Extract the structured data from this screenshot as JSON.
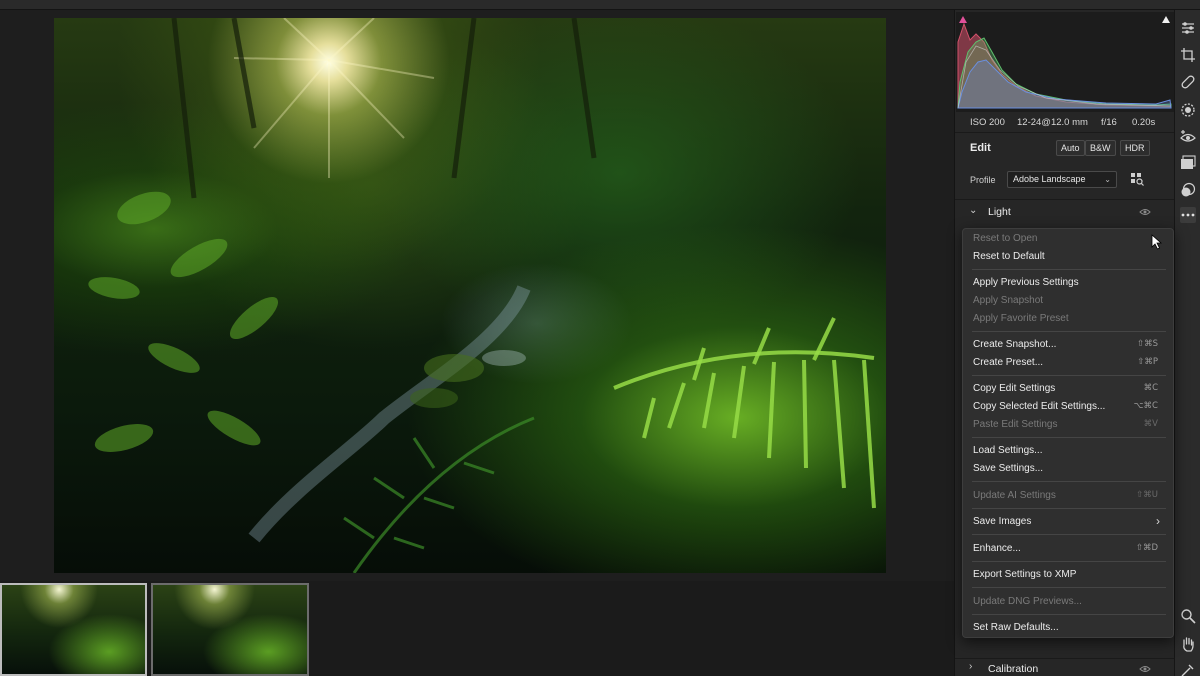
{
  "camera_info": {
    "iso": "ISO 200",
    "lens": "12-24@12.0 mm",
    "aperture": "f/16",
    "shutter": "0.20s"
  },
  "edit_panel": {
    "title": "Edit",
    "buttons": {
      "auto": "Auto",
      "bw": "B&W",
      "hdr": "HDR"
    },
    "profile_label": "Profile",
    "profile_value": "Adobe Landscape"
  },
  "sections": {
    "light": "Light",
    "calibration": "Calibration"
  },
  "context_menu": {
    "items": [
      {
        "label": "Reset to Open",
        "shortcut": "",
        "enabled": false
      },
      {
        "label": "Reset to Default",
        "shortcut": "",
        "enabled": true
      },
      {
        "label": "Apply Previous Settings",
        "shortcut": "",
        "enabled": true
      },
      {
        "label": "Apply Snapshot",
        "shortcut": "",
        "enabled": false
      },
      {
        "label": "Apply Favorite Preset",
        "shortcut": "",
        "enabled": false
      },
      {
        "label": "Create Snapshot...",
        "shortcut": "⇧⌘S",
        "enabled": true
      },
      {
        "label": "Create Preset...",
        "shortcut": "⇧⌘P",
        "enabled": true
      },
      {
        "label": "Copy Edit Settings",
        "shortcut": "⌘C",
        "enabled": true
      },
      {
        "label": "Copy Selected Edit Settings...",
        "shortcut": "⌥⌘C",
        "enabled": true
      },
      {
        "label": "Paste Edit Settings",
        "shortcut": "⌘V",
        "enabled": false
      },
      {
        "label": "Load Settings...",
        "shortcut": "",
        "enabled": true
      },
      {
        "label": "Save Settings...",
        "shortcut": "",
        "enabled": true
      },
      {
        "label": "Update AI Settings",
        "shortcut": "⇧⌘U",
        "enabled": false
      },
      {
        "label": "Save Images",
        "shortcut": "",
        "enabled": true,
        "submenu": true
      },
      {
        "label": "Enhance...",
        "shortcut": "⇧⌘D",
        "enabled": true
      },
      {
        "label": "Export Settings to XMP",
        "shortcut": "",
        "enabled": true
      },
      {
        "label": "Update DNG Previews...",
        "shortcut": "",
        "enabled": false
      },
      {
        "label": "Set Raw Defaults...",
        "shortcut": "",
        "enabled": true
      }
    ]
  },
  "icons": {
    "toolstrip": [
      "sliders-icon",
      "crop-icon",
      "healing-icon",
      "mask-icon",
      "redeye-icon",
      "snapshots-icon",
      "presets-icon",
      "more-icon",
      "zoom-icon",
      "hand-icon",
      "sampler-icon"
    ]
  },
  "colors": {
    "panel_bg": "#262626",
    "menu_bg": "#2f2f2f",
    "app_bg": "#1e1e1e",
    "histogram_red": "#d2506a",
    "histogram_green": "#5fc26e",
    "histogram_blue": "#6a8fe0"
  }
}
